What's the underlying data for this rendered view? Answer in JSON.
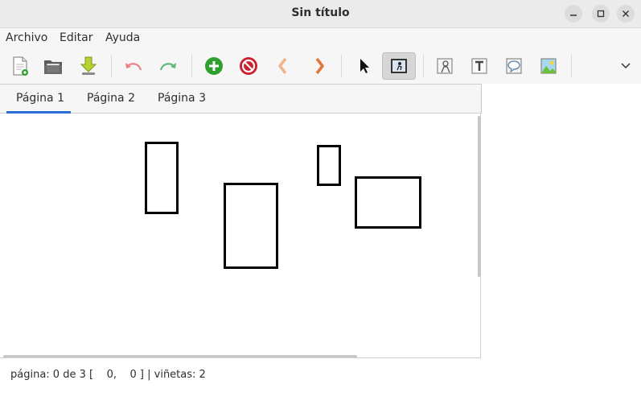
{
  "window": {
    "title": "Sin título"
  },
  "menubar": {
    "items": [
      "Archivo",
      "Editar",
      "Ayuda"
    ]
  },
  "toolbar": {
    "buttons": [
      {
        "name": "new-file-icon"
      },
      {
        "name": "open-folder-icon"
      },
      {
        "name": "save-download-icon"
      },
      {
        "name": "undo-icon"
      },
      {
        "name": "redo-icon"
      },
      {
        "name": "add-page-icon"
      },
      {
        "name": "delete-page-icon"
      },
      {
        "name": "previous-page-icon"
      },
      {
        "name": "next-page-icon"
      },
      {
        "name": "select-pointer-icon"
      },
      {
        "name": "panel-tool-icon",
        "active": true
      },
      {
        "name": "character-tool-icon"
      },
      {
        "name": "text-tool-icon"
      },
      {
        "name": "speech-bubble-tool-icon"
      },
      {
        "name": "image-tool-icon"
      },
      {
        "name": "more-options-chevron-icon"
      }
    ]
  },
  "tabs": {
    "items": [
      "Página 1",
      "Página 2",
      "Página 3"
    ],
    "selected": "Página 1"
  },
  "status": {
    "text": "página: 0 de 3 [    0,    0 ] | viñetas: 2"
  },
  "colors": {
    "accent": "#2a6fd6",
    "add": "#2ea02e",
    "delete": "#cc1f2f",
    "arrows": "#e8864a",
    "undo": "#e8828a",
    "redo": "#5fb87a"
  }
}
